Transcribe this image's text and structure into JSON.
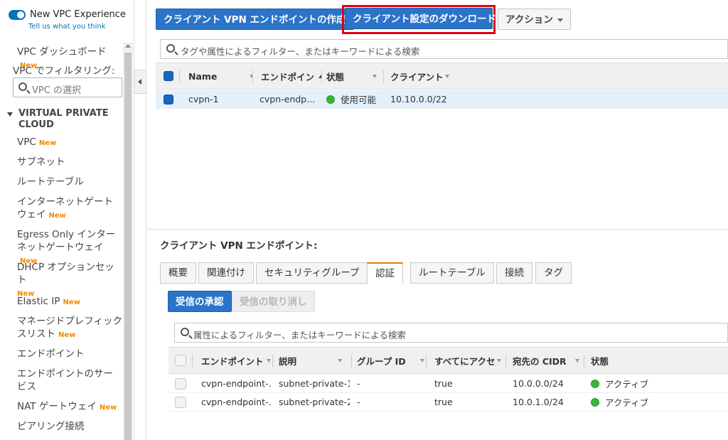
{
  "vpc_experience": {
    "title": "New VPC Experience",
    "link": "Tell us what you think"
  },
  "sidebar": {
    "dashboard": "VPC ダッシュボード",
    "new_badge": "New",
    "filter_label": "VPC でフィルタリング:",
    "filter_placeholder": "VPC の選択",
    "section": "VIRTUAL PRIVATE CLOUD",
    "items": [
      {
        "label": "VPC",
        "new": "New"
      },
      {
        "label": "サブネット",
        "new": ""
      },
      {
        "label": "ルートテーブル",
        "new": ""
      },
      {
        "label": "インターネットゲートウェイ",
        "new": "New"
      },
      {
        "label": "Egress Only インターネットゲートウェイ",
        "new": "New"
      },
      {
        "label": "DHCP オプションセット",
        "new": "New"
      },
      {
        "label": "Elastic IP",
        "new": "New"
      },
      {
        "label": "マネージドプレフィックスリスト",
        "new": "New"
      },
      {
        "label": "エンドポイント",
        "new": ""
      },
      {
        "label": "エンドポイントのサービス",
        "new": ""
      },
      {
        "label": "NAT ゲートウェイ",
        "new": "New"
      },
      {
        "label": "ピアリング接続",
        "new": ""
      }
    ]
  },
  "toolbar": {
    "create_button": "クライアント VPN エンドポイントの作成",
    "download_button": "クライアント設定のダウンロード",
    "actions_button": "アクション"
  },
  "top_search": {
    "placeholder": "タグや属性によるフィルター、またはキーワードによる検索"
  },
  "top_table": {
    "headers": [
      "Name",
      "エンドポイン",
      "状態",
      "クライアント"
    ],
    "rows": [
      {
        "name": "cvpn-1",
        "endpoint": "cvpn-endp...",
        "status": "使用可能",
        "client": "10.10.0.0/22"
      }
    ]
  },
  "detail": {
    "title": "クライアント VPN エンドポイント:",
    "tabs": [
      "概要",
      "関連付け",
      "セキュリティグループ",
      "認証",
      "ルートテーブル",
      "接続",
      "タグ"
    ],
    "active_tab": "認証",
    "authorize_button": "受信の承認",
    "revoke_button": "受信の取り消し",
    "search_placeholder": "属性によるフィルター、またはキーワードによる検索",
    "headers": [
      "エンドポイント",
      "説明",
      "グループ ID",
      "すべてにアクセ",
      "宛先の CIDR",
      "状態"
    ],
    "rows": [
      {
        "endpoint": "cvpn-endpoint-...",
        "description": "subnet-private-1",
        "group": "-",
        "access": "true",
        "cidr": "10.0.0.0/24",
        "status": "アクティブ"
      },
      {
        "endpoint": "cvpn-endpoint-...",
        "description": "subnet-private-2",
        "group": "-",
        "access": "true",
        "cidr": "10.0.1.0/24",
        "status": "アクティブ"
      }
    ]
  },
  "colors": {
    "primary": "#2b74c9",
    "highlight": "#e3000f",
    "new_badge": "#f08a00",
    "status_ok": "#3ab53a",
    "active_tab": "#e47911"
  }
}
